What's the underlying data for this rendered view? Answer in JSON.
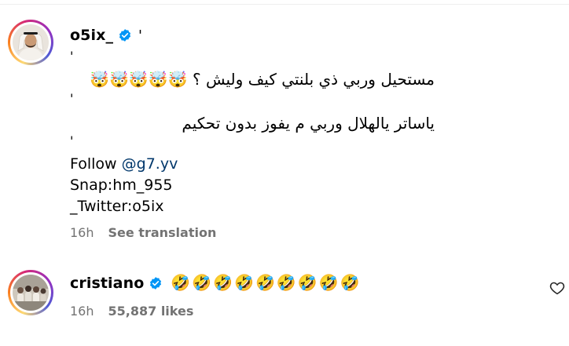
{
  "comments": [
    {
      "username": "o5ix_",
      "verified": true,
      "separator": "'",
      "ticks": [
        "'",
        "'",
        "'"
      ],
      "line1": "مستحيل وربي ذي بلنتي كيف وليش ؟",
      "line1_emoji": "🤯🤯🤯🤯🤯",
      "line2": "ياساتر يالهلال وربي م يفوز بدون تحكيم",
      "follow_prefix": "Follow ",
      "follow_link": "@g7.yv",
      "snap": "Snap:hm_955",
      "twitter": "_Twitter:o5ix",
      "time": "16h",
      "action": "See translation"
    },
    {
      "username": "cristiano",
      "verified": true,
      "emojis": "🤣🤣🤣🤣🤣🤣🤣🤣🤣",
      "time": "16h",
      "likes": "55,887 likes"
    }
  ],
  "icons": {
    "verified": "verified-badge-icon",
    "like": "heart-icon"
  },
  "colors": {
    "verified": "#0095f6",
    "link": "#00376b",
    "meta": "#737373"
  }
}
